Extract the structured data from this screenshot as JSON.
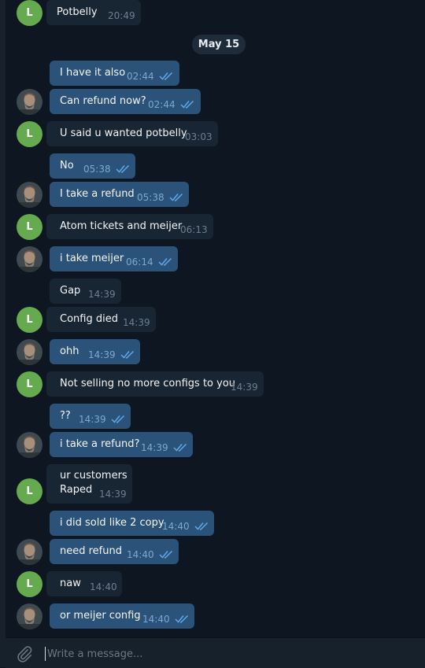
{
  "composer": {
    "placeholder": "Write a message..."
  },
  "date_separator": "May 15",
  "colors": {
    "background": "#0e1621",
    "incoming": "#182533",
    "outgoing": "#2b5278",
    "avatar_green": "#65aa4f",
    "check_blue": "#5fa8e9"
  },
  "icons": {
    "attach": "paperclip-icon",
    "read": "double-check-icon"
  },
  "messages": [
    {
      "dir": "in",
      "text": "Potbelly",
      "time": "20:49",
      "avatar_initial": "L"
    },
    {
      "dir": "out",
      "text": "I have it also",
      "time": "02:44"
    },
    {
      "dir": "out",
      "text": "Can refund now?",
      "time": "02:44"
    },
    {
      "dir": "in",
      "text": "U said u wanted potbelly",
      "time": "03:03",
      "avatar_initial": "L"
    },
    {
      "dir": "out",
      "text": "No",
      "time": "05:38"
    },
    {
      "dir": "out",
      "text": "I take a refund",
      "time": "05:38"
    },
    {
      "dir": "in",
      "text": "Atom tickets and meijer",
      "time": "06:13",
      "avatar_initial": "L"
    },
    {
      "dir": "out",
      "text": "i take meijer",
      "time": "06:14"
    },
    {
      "dir": "in",
      "text": "Gap",
      "time": "14:39"
    },
    {
      "dir": "in",
      "text": "Config died",
      "time": "14:39",
      "avatar_initial": "L"
    },
    {
      "dir": "out",
      "text": "ohh",
      "time": "14:39"
    },
    {
      "dir": "in",
      "text": "Not selling no more configs to you",
      "time": "14:39",
      "avatar_initial": "L"
    },
    {
      "dir": "out",
      "text": "??",
      "time": "14:39"
    },
    {
      "dir": "out",
      "text": "i take a refund?",
      "time": "14:39"
    },
    {
      "dir": "in",
      "line1": "ur customers",
      "line2": "Raped",
      "time": "14:39",
      "avatar_initial": "L"
    },
    {
      "dir": "out",
      "text": "i did sold like 2 copy",
      "time": "14:40"
    },
    {
      "dir": "out",
      "text": "need refund",
      "time": "14:40"
    },
    {
      "dir": "in",
      "text": "naw",
      "time": "14:40",
      "avatar_initial": "L"
    },
    {
      "dir": "out",
      "text": "or meijer config",
      "time": "14:40"
    }
  ]
}
